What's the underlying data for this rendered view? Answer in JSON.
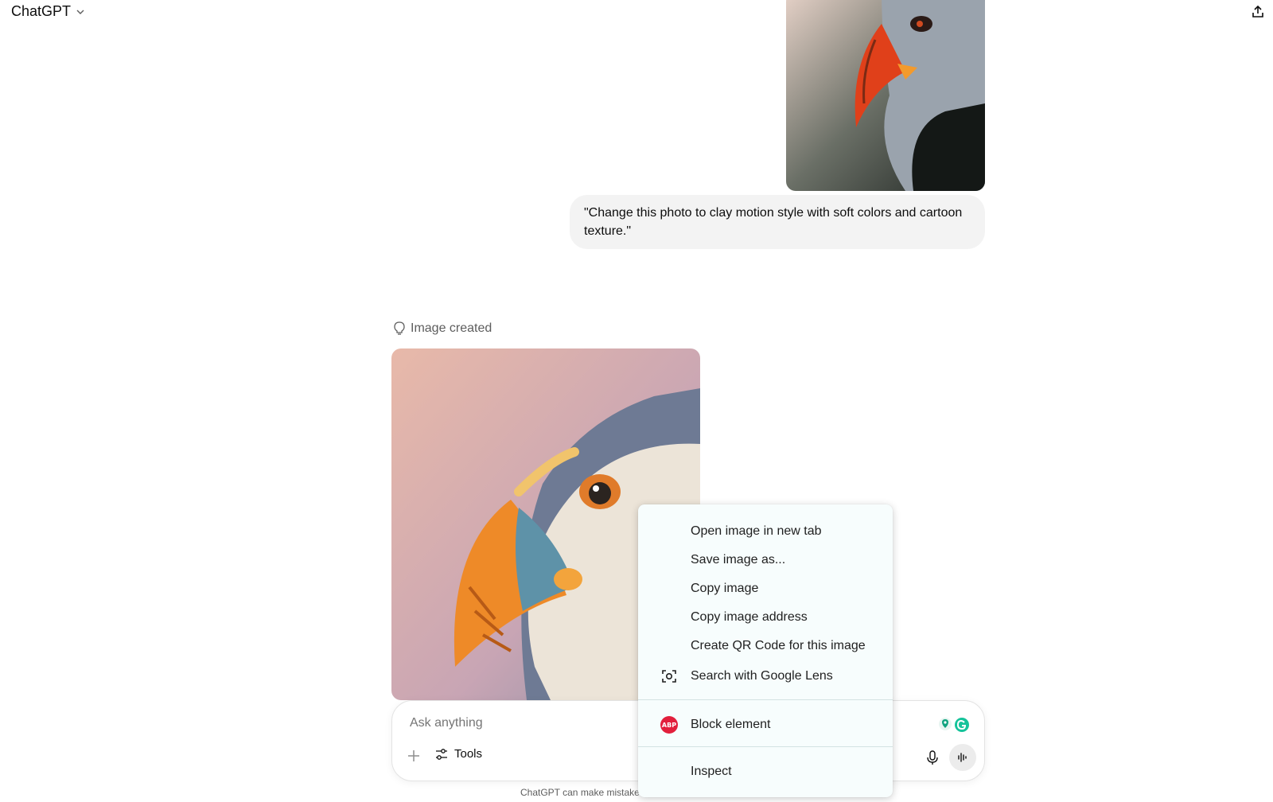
{
  "header": {
    "model_label": "ChatGPT",
    "share_icon": "share-icon"
  },
  "conversation": {
    "user_prompt": "\"Change this photo to clay motion style with soft colors and cartoon texture.\"",
    "assistant_status": "Image created"
  },
  "composer": {
    "placeholder": "Ask anything",
    "tools_label": "Tools"
  },
  "disclaimer": "ChatGPT can make mistake",
  "context_menu": {
    "items": [
      "Open image in new tab",
      "Save image as...",
      "Copy image",
      "Copy image address",
      "Create QR Code for this image",
      "Search with Google Lens",
      "Block element",
      "Inspect"
    ],
    "abp_badge": "ABP"
  },
  "colors": {
    "bubble_bg": "#f3f3f3",
    "menu_bg": "#f7fdfd",
    "abp_red": "#e21f3c",
    "extension_teal": "#10a37f"
  }
}
